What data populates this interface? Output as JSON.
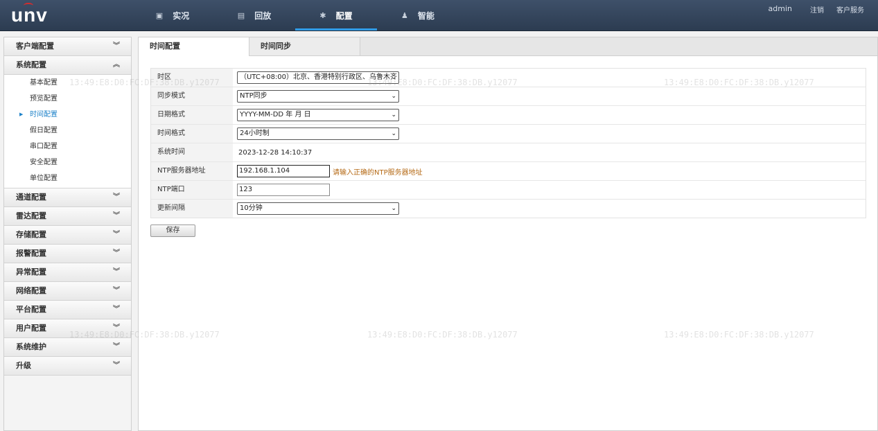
{
  "header": {
    "logo": "unv",
    "nav": [
      {
        "label": "实况",
        "icon": "monitor-icon"
      },
      {
        "label": "回放",
        "icon": "film-icon"
      },
      {
        "label": "配置",
        "icon": "gear-icon",
        "active": true
      },
      {
        "label": "智能",
        "icon": "person-icon"
      }
    ],
    "user": "admin",
    "logout": "注销",
    "service": "客户服务"
  },
  "sidebar": {
    "groups": [
      {
        "label": "客户端配置",
        "expanded": false
      },
      {
        "label": "系统配置",
        "expanded": true,
        "items": [
          "基本配置",
          "预览配置",
          "时间配置",
          "假日配置",
          "串口配置",
          "安全配置",
          "单位配置"
        ],
        "active_item": "时间配置"
      },
      {
        "label": "通道配置",
        "expanded": false
      },
      {
        "label": "雷达配置",
        "expanded": false
      },
      {
        "label": "存储配置",
        "expanded": false
      },
      {
        "label": "报警配置",
        "expanded": false
      },
      {
        "label": "异常配置",
        "expanded": false
      },
      {
        "label": "网络配置",
        "expanded": false
      },
      {
        "label": "平台配置",
        "expanded": false
      },
      {
        "label": "用户配置",
        "expanded": false
      },
      {
        "label": "系统维护",
        "expanded": false
      },
      {
        "label": "升级",
        "expanded": false
      }
    ]
  },
  "tabs": [
    "时间配置",
    "时间同步"
  ],
  "form": {
    "timezone_label": "时区",
    "timezone_value": "（UTC+08:00）北京、香港特别行政区、乌鲁木齐",
    "sync_mode_label": "同步模式",
    "sync_mode_value": "NTP同步",
    "date_format_label": "日期格式",
    "date_format_value": "YYYY-MM-DD 年 月 日",
    "time_format_label": "时间格式",
    "time_format_value": "24小时制",
    "system_time_label": "系统时间",
    "system_time_value": "2023-12-28 14:10:37",
    "ntp_server_label": "NTP服务器地址",
    "ntp_server_value": "192.168.1.104",
    "ntp_server_hint": "请输入正确的NTP服务器地址",
    "ntp_port_label": "NTP端口",
    "ntp_port_value": "123",
    "interval_label": "更新间隔",
    "interval_value": "10分钟"
  },
  "save_label": "保存",
  "watermark": "13:49:E8:D0:FC:DF:38:DB.y12077"
}
